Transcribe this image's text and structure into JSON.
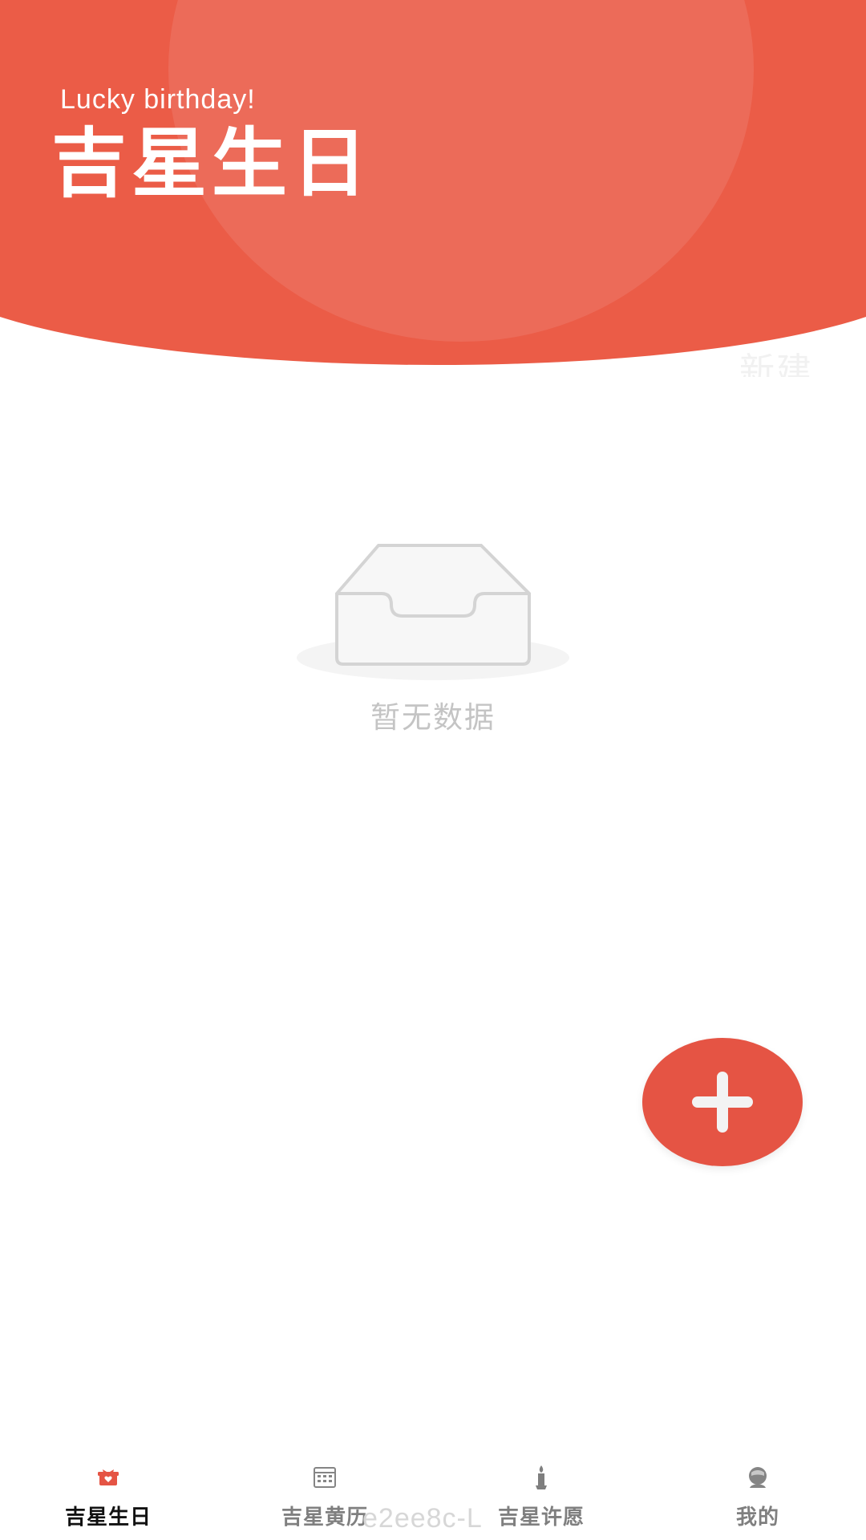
{
  "header": {
    "subtitle": "Lucky birthday!",
    "title": "吉星生日",
    "new_label": "新建",
    "accent_color": "#eb5c47"
  },
  "empty_state": {
    "message": "暂无数据",
    "icon": "empty-inbox-icon"
  },
  "fab": {
    "icon": "plus-icon",
    "color": "#e55444"
  },
  "tabbar": {
    "items": [
      {
        "label": "吉星生日",
        "icon": "gift-icon",
        "active": true
      },
      {
        "label": "吉星黄历",
        "icon": "calendar-icon",
        "active": false
      },
      {
        "label": "吉星许愿",
        "icon": "candle-icon",
        "active": false
      },
      {
        "label": "我的",
        "icon": "user-icon",
        "active": false
      }
    ]
  },
  "watermark": {
    "text": "e2ee8c-L"
  }
}
